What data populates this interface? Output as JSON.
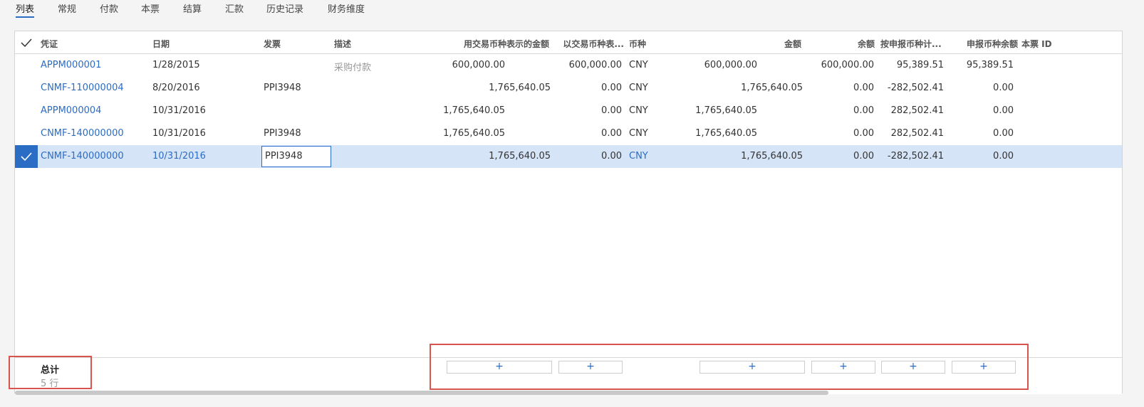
{
  "tabs": [
    "列表",
    "常规",
    "付款",
    "本票",
    "结算",
    "汇款",
    "历史记录",
    "财务维度"
  ],
  "columns": {
    "voucher": "凭证",
    "date": "日期",
    "invoice": "发票",
    "description": "描述",
    "amount_txn": "用交易币种表示的金额",
    "balance_txn": "以交易币种表...",
    "currency": "币种",
    "amount": "金额",
    "balance": "余额",
    "reporting_amount": "按申报币种计...",
    "reporting_balance": "申报币种余额",
    "promissory_id": "本票 ID"
  },
  "rows": [
    {
      "voucher": "APPM000001",
      "date": "1/28/2015",
      "invoice": "",
      "description": "采购付款",
      "amount_txn": "600,000.00",
      "balance_txn": "600,000.00",
      "currency": "CNY",
      "amount": "600,000.00",
      "balance": "600,000.00",
      "reporting_amount": "95,389.51",
      "reporting_balance": "95,389.51"
    },
    {
      "voucher": "CNMF-110000004",
      "date": "8/20/2016",
      "invoice": "PPI3948",
      "description": "",
      "amount_txn": "1,765,640.05",
      "balance_txn": "0.00",
      "currency": "CNY",
      "amount": "1,765,640.05",
      "balance": "0.00",
      "reporting_amount": "-282,502.41",
      "reporting_balance": "0.00"
    },
    {
      "voucher": "APPM000004",
      "date": "10/31/2016",
      "invoice": "",
      "description": "",
      "amount_txn": "1,765,640.05",
      "balance_txn": "0.00",
      "currency": "CNY",
      "amount": "1,765,640.05",
      "balance": "0.00",
      "reporting_amount": "282,502.41",
      "reporting_balance": "0.00"
    },
    {
      "voucher": "CNMF-140000000",
      "date": "10/31/2016",
      "invoice": "PPI3948",
      "description": "",
      "amount_txn": "1,765,640.05",
      "balance_txn": "0.00",
      "currency": "CNY",
      "amount": "1,765,640.05",
      "balance": "0.00",
      "reporting_amount": "282,502.41",
      "reporting_balance": "0.00"
    },
    {
      "voucher": "CNMF-140000000",
      "date": "10/31/2016",
      "invoice": "PPI3948",
      "description": "",
      "amount_txn": "1,765,640.05",
      "balance_txn": "0.00",
      "currency": "CNY",
      "amount": "1,765,640.05",
      "balance": "0.00",
      "reporting_amount": "-282,502.41",
      "reporting_balance": "0.00"
    }
  ],
  "footer": {
    "total_label": "总计",
    "row_count": "5 行",
    "add_symbol": "+"
  },
  "colors": {
    "accent": "#2b6cc4",
    "selected_row": "#d6e4f7",
    "highlight": "#d9534f"
  }
}
